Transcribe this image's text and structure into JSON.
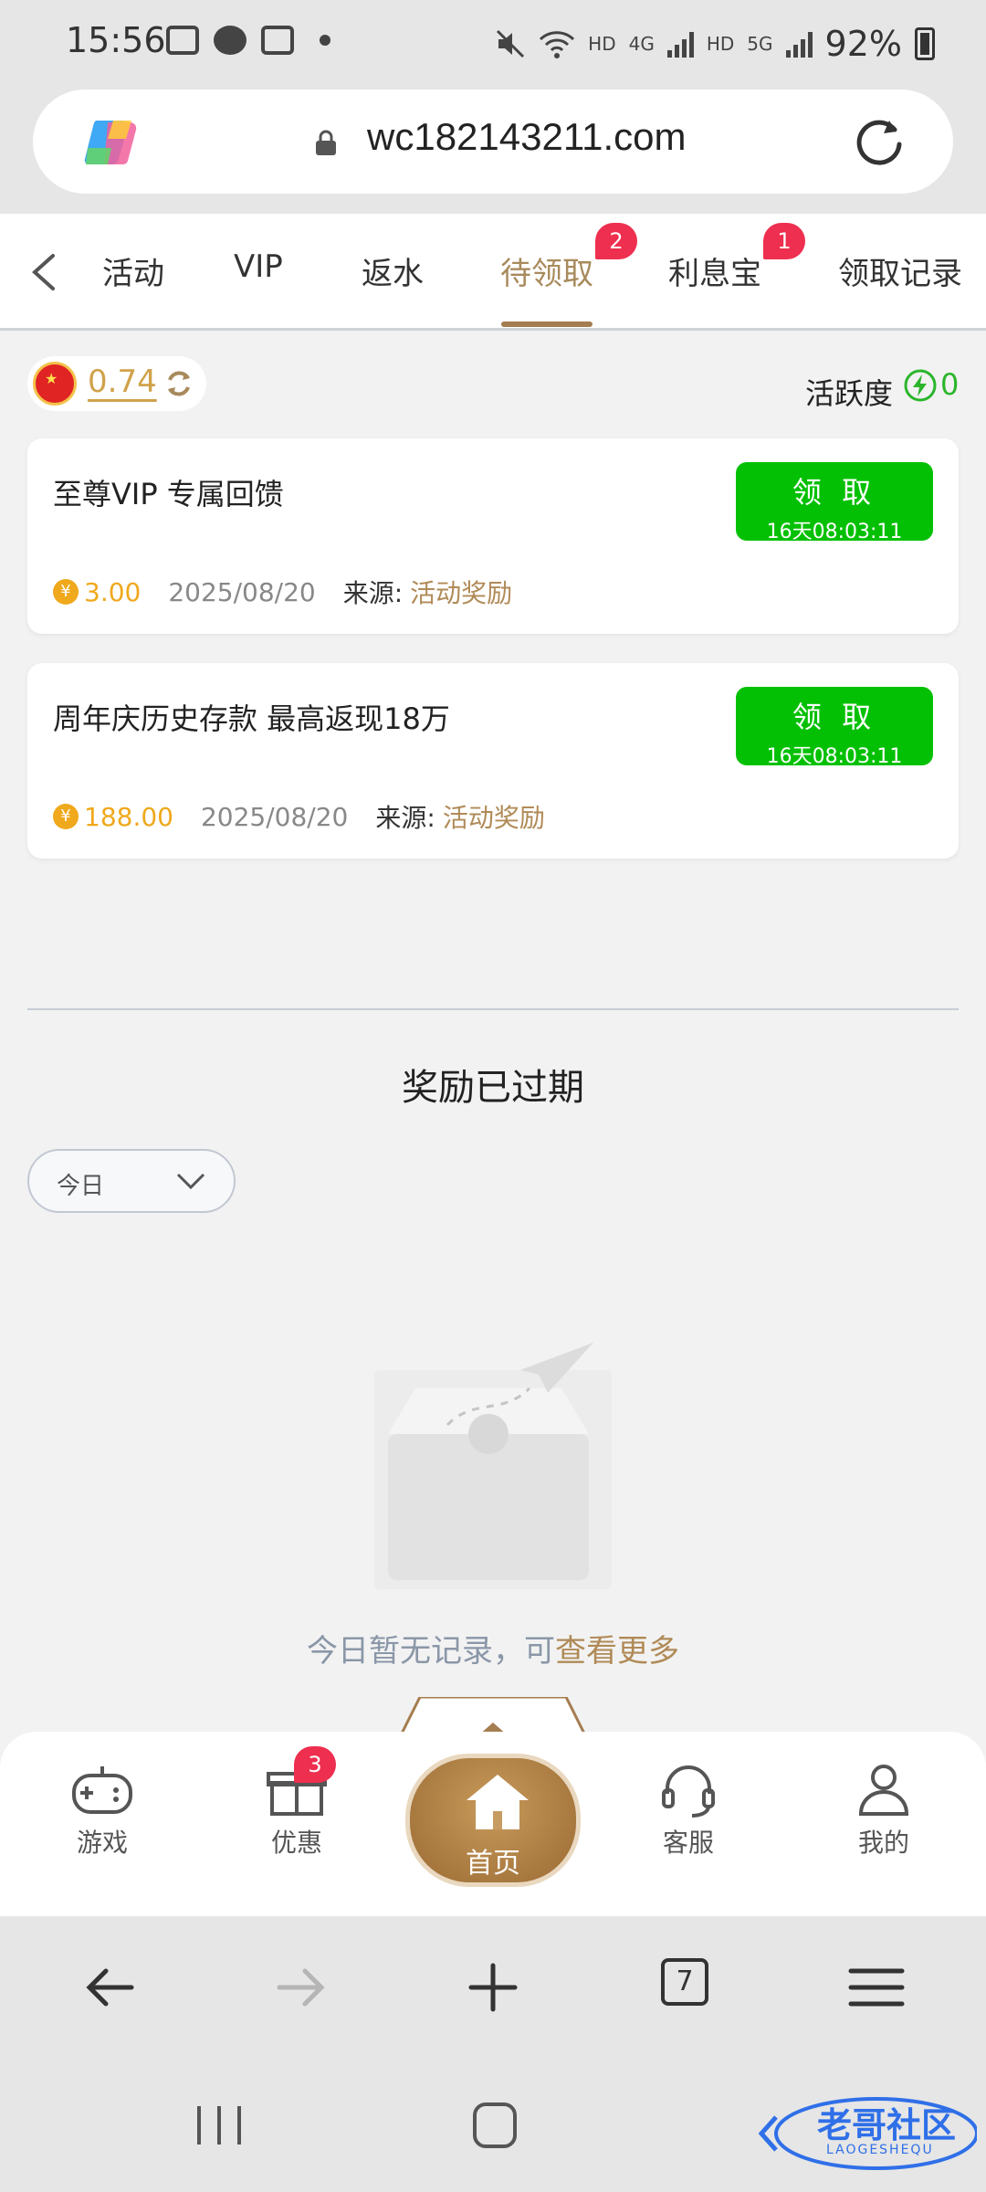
{
  "status_bar": {
    "time": "15:56",
    "battery": "92%",
    "net_labels": [
      "HD",
      "4G",
      "HD",
      "5G"
    ]
  },
  "browser": {
    "url": "wc182143211.com",
    "tab_count": "7"
  },
  "tabs": [
    {
      "label": "活动"
    },
    {
      "label": "VIP"
    },
    {
      "label": "返水"
    },
    {
      "label": "待领取",
      "badge": "2",
      "active": true
    },
    {
      "label": "利息宝",
      "badge": "1"
    },
    {
      "label": "领取记录"
    }
  ],
  "balance": {
    "amount": "0.74",
    "activity_label": "活跃度",
    "activity_value": "0"
  },
  "rewards": [
    {
      "title": "至尊VIP 专属回馈",
      "claim_label": "领 取",
      "countdown": "16天08:03:11",
      "coin_symbol": "¥",
      "amount": "3.00",
      "date": "2025/08/20",
      "source_label": "来源:",
      "source_value": "活动奖励"
    },
    {
      "title": "周年庆历史存款 最高返现18万",
      "claim_label": "领 取",
      "countdown": "16天08:03:11",
      "coin_symbol": "¥",
      "amount": "188.00",
      "date": "2025/08/20",
      "source_label": "来源:",
      "source_value": "活动奖励"
    }
  ],
  "expired": {
    "title": "奖励已过期",
    "filter_value": "今日",
    "empty_text": "今日暂无记录，可",
    "empty_link": "查看更多"
  },
  "bottom_nav": {
    "games": "游戏",
    "promos": "优惠",
    "promos_badge": "3",
    "home": "首页",
    "service": "客服",
    "mine": "我的"
  },
  "watermark": {
    "text": "老哥社区",
    "sub": "LAOGESHEQU"
  },
  "colors": {
    "accent": "#a88a5c",
    "claim_green": "#04c004",
    "badge_red": "#ee2f4f",
    "coin_gold": "#f0a81c"
  }
}
